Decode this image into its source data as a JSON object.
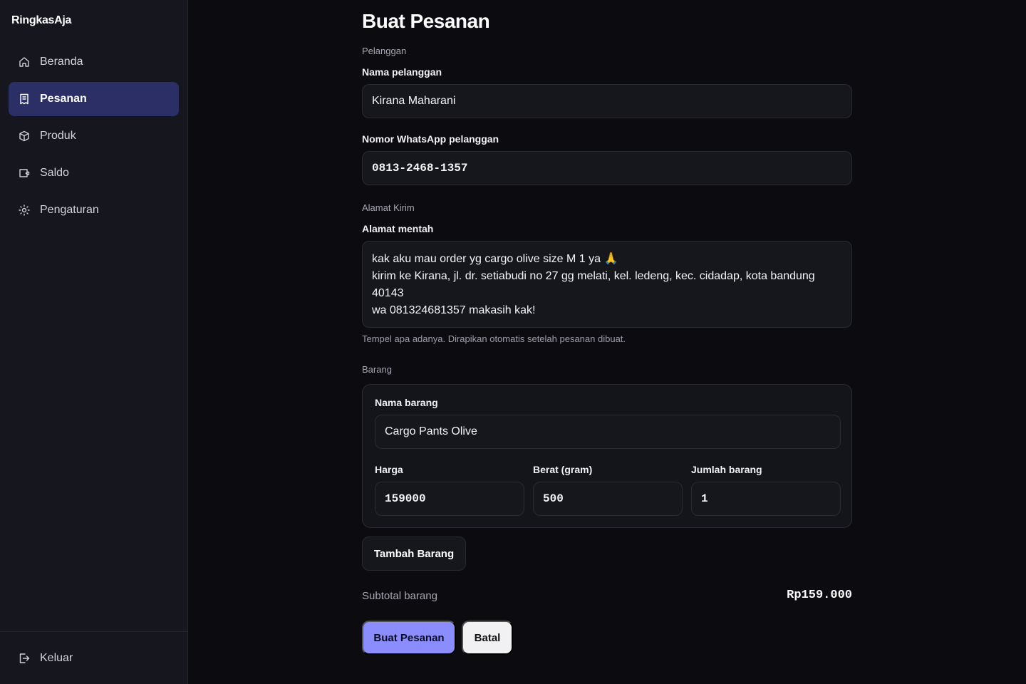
{
  "app": {
    "brand": "RingkasAja"
  },
  "sidebar": {
    "items": [
      {
        "label": "Beranda",
        "icon": "home-icon",
        "active": false
      },
      {
        "label": "Pesanan",
        "icon": "receipt-icon",
        "active": true
      },
      {
        "label": "Produk",
        "icon": "box-icon",
        "active": false
      },
      {
        "label": "Saldo",
        "icon": "wallet-icon",
        "active": false
      },
      {
        "label": "Pengaturan",
        "icon": "sun-gear-icon",
        "active": false
      }
    ],
    "logout": {
      "label": "Keluar",
      "icon": "logout-icon"
    }
  },
  "page": {
    "title": "Buat Pesanan",
    "customer": {
      "section": "Pelanggan",
      "name_label": "Nama pelanggan",
      "name_value": "Kirana Maharani",
      "phone_label": "Nomor WhatsApp pelanggan",
      "phone_value": "0813-2468-1357"
    },
    "address": {
      "section": "Alamat Kirim",
      "raw_label": "Alamat mentah",
      "raw_value": "kak aku mau order yg cargo olive size M 1 ya 🙏\nkirim ke Kirana, jl. dr. setiabudi no 27 gg melati, kel. ledeng, kec. cidadap, kota bandung 40143\nwa 081324681357 makasih kak!",
      "hint": "Tempel apa adanya. Dirapikan otomatis setelah pesanan dibuat."
    },
    "items": {
      "section": "Barang",
      "name_label": "Nama barang",
      "name_value": "Cargo Pants Olive",
      "price_label": "Harga",
      "price_value": "159000",
      "weight_label": "Berat (gram)",
      "weight_value": "500",
      "qty_label": "Jumlah barang",
      "qty_value": "1",
      "add_button": "Tambah Barang"
    },
    "subtotal": {
      "label": "Subtotal barang",
      "value": "Rp159.000"
    },
    "actions": {
      "submit": "Buat Pesanan",
      "cancel": "Batal"
    }
  },
  "colors": {
    "accent": "#8b8dff",
    "active_nav": "#2b2f66",
    "background": "#0b0b10",
    "sidebar": "#16161f"
  }
}
